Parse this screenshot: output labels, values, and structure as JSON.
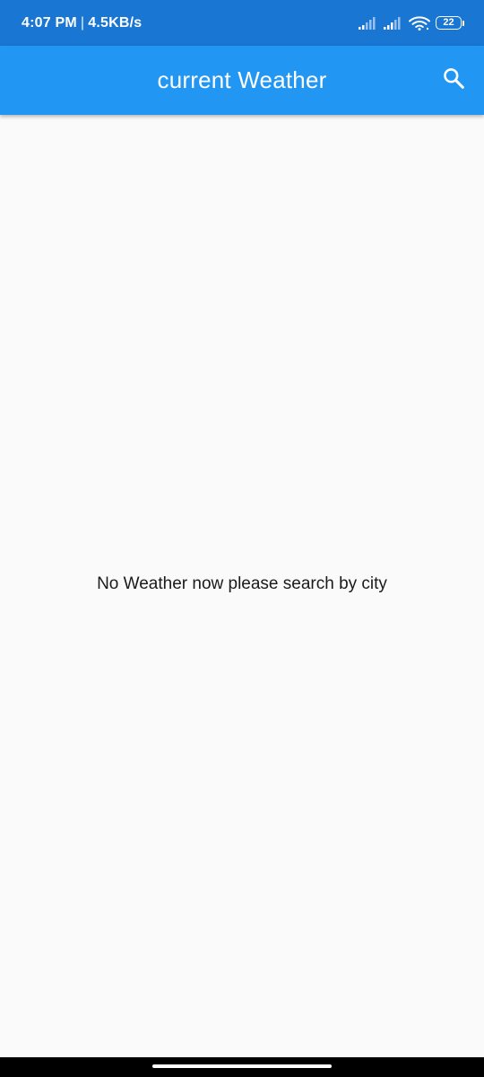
{
  "status_bar": {
    "time": "4:07 PM",
    "separator": "|",
    "network_speed": "4.5KB/s",
    "battery_level": "22",
    "icons": [
      "signal-icon",
      "signal-icon",
      "wifi-icon",
      "battery-icon"
    ]
  },
  "app_bar": {
    "title": "current Weather",
    "action_icon": "search-icon"
  },
  "main": {
    "empty_message": "No Weather now please search by city"
  },
  "colors": {
    "status_bar": "#1976d2",
    "app_bar": "#2196f3",
    "background": "#fafafa",
    "text": "#1a1a1a"
  }
}
